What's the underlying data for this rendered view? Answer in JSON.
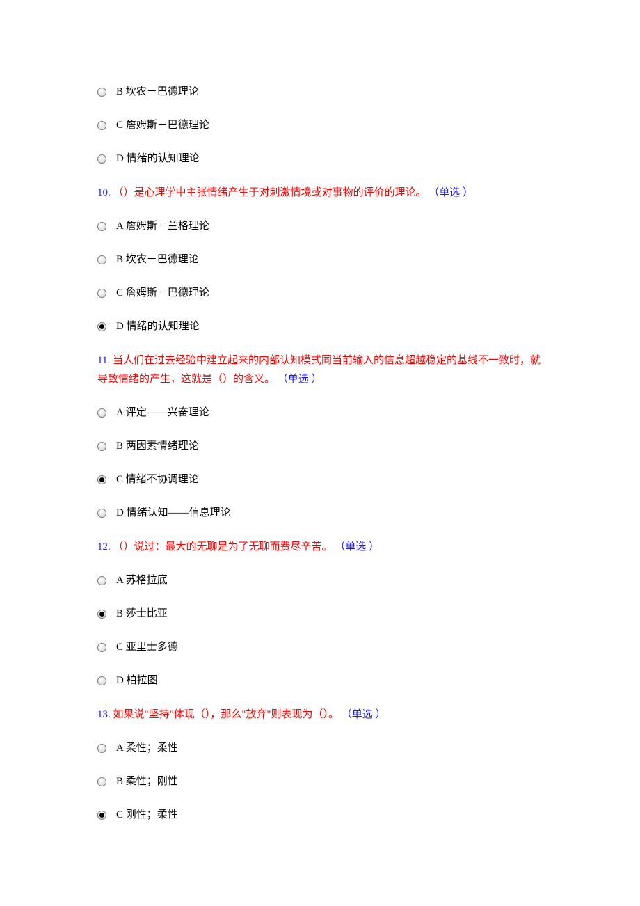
{
  "orphan_options": [
    {
      "label": "B 坎农－巴德理论",
      "selected": false
    },
    {
      "label": "C 詹姆斯－巴德理论",
      "selected": false
    },
    {
      "label": "D 情绪的认知理论",
      "selected": false
    }
  ],
  "questions": [
    {
      "number": "10.",
      "text": "（）是心理学中主张情绪产生于对刺激情境或对事物的评价的理论。",
      "type": "（单选 ）",
      "options": [
        {
          "label": "A 詹姆斯－兰格理论",
          "selected": false
        },
        {
          "label": "B 坎农－巴德理论",
          "selected": false
        },
        {
          "label": "C 詹姆斯－巴德理论",
          "selected": false
        },
        {
          "label": "D 情绪的认知理论",
          "selected": true
        }
      ]
    },
    {
      "number": "11.",
      "text": "当人们在过去经验中建立起来的内部认知模式同当前输入的信息超越稳定的基线不一致时，就导致情绪的产生，这就是（）的含义。",
      "type": "（单选 ）",
      "options": [
        {
          "label": "A 评定——兴奋理论",
          "selected": false
        },
        {
          "label": "B 两因素情绪理论",
          "selected": false
        },
        {
          "label": "C 情绪不协调理论",
          "selected": true
        },
        {
          "label": "D 情绪认知——信息理论",
          "selected": false
        }
      ]
    },
    {
      "number": "12.",
      "text": "（）说过：最大的无聊是为了无聊而费尽辛苦。",
      "type": "（单选 ）",
      "options": [
        {
          "label": "A 苏格拉底",
          "selected": false
        },
        {
          "label": "B 莎士比亚",
          "selected": true
        },
        {
          "label": "C 亚里士多德",
          "selected": false
        },
        {
          "label": "D 柏拉图",
          "selected": false
        }
      ]
    },
    {
      "number": "13.",
      "text": "如果说\"坚持\"体现（），那么\"放弃\"则表现为（）。",
      "type": "（单选 ）",
      "options": [
        {
          "label": "A 柔性；柔性",
          "selected": false
        },
        {
          "label": "B 柔性；刚性",
          "selected": false
        },
        {
          "label": "C 刚性；柔性",
          "selected": true
        }
      ]
    }
  ]
}
